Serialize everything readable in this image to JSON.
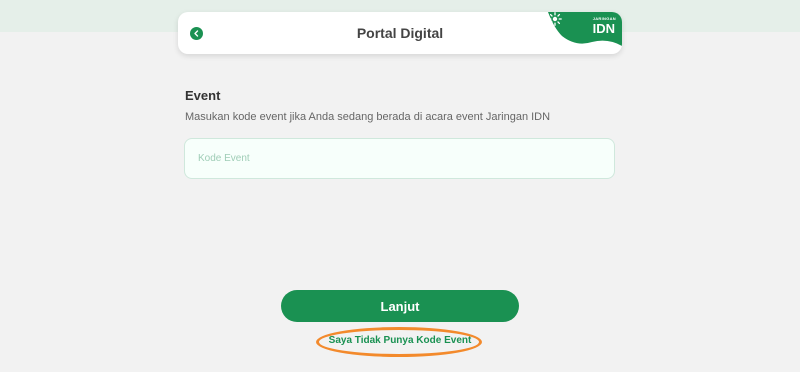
{
  "header": {
    "title": "Portal Digital",
    "brand_small": "JARINGAN",
    "brand_big": "IDN",
    "brand_color": "#1a9152"
  },
  "event": {
    "title": "Event",
    "description": "Masukan kode event jika Anda sedang berada di acara event Jaringan IDN",
    "input_placeholder": "Kode Event",
    "input_value": ""
  },
  "actions": {
    "submit_label": "Lanjut",
    "no_code_link": "Saya Tidak Punya Kode Event",
    "highlight_color": "#f38a2c"
  },
  "icons": {
    "back": "chevron-left-icon",
    "brand_logo": "burst-icon"
  }
}
